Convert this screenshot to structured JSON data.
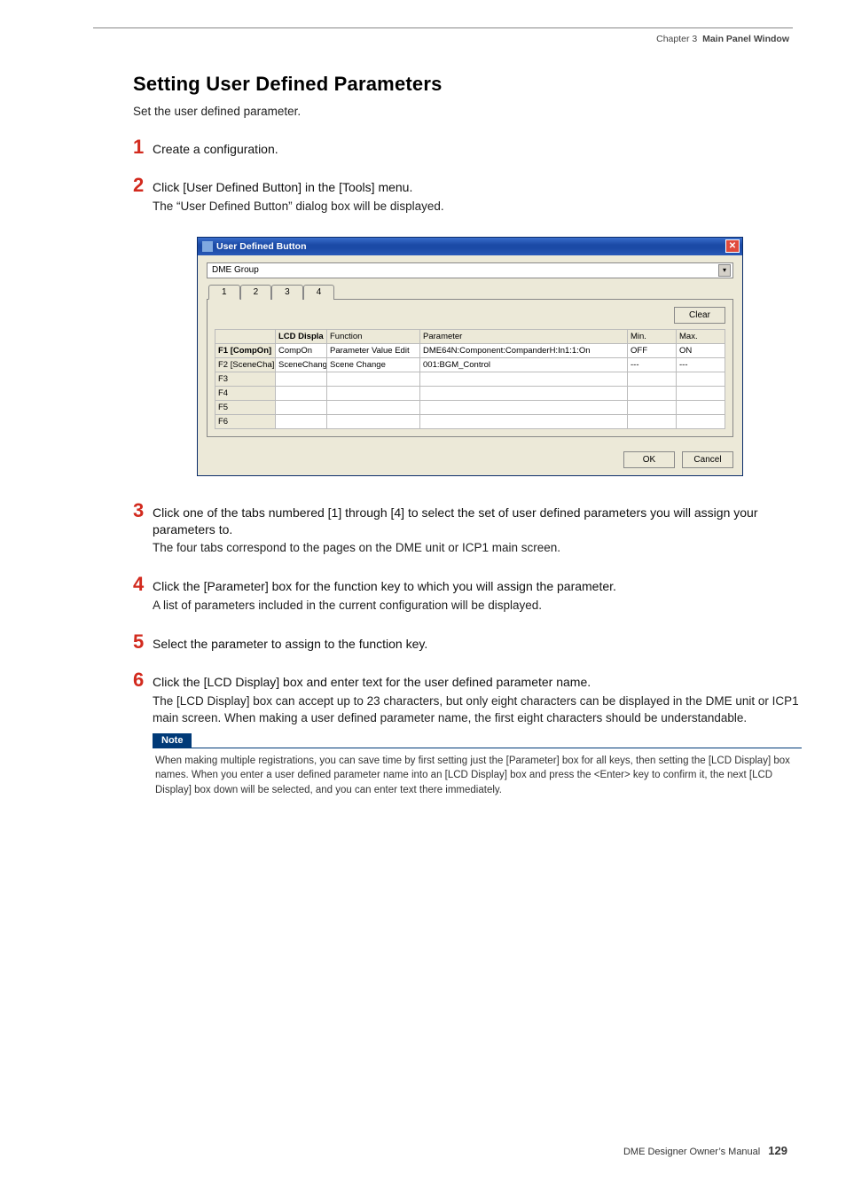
{
  "header": {
    "chapter": "Chapter 3",
    "title": "Main Panel Window"
  },
  "page": {
    "h1": "Setting User Defined Parameters",
    "intro": "Set the user defined parameter.",
    "steps": {
      "s1": {
        "n": "1",
        "head": "Create a configuration."
      },
      "s2": {
        "n": "2",
        "head": "Click [User Defined Button] in the [Tools] menu.",
        "sub": "The “User Defined Button” dialog box will be displayed."
      },
      "s3": {
        "n": "3",
        "head": "Click one of the tabs numbered [1] through [4] to select the set of user defined parameters you will assign your parameters to.",
        "sub": "The four tabs correspond to the pages on the DME unit or ICP1 main screen."
      },
      "s4": {
        "n": "4",
        "head": "Click the [Parameter] box for the function key to which you will assign the parameter.",
        "sub": "A list of parameters included in the current configuration will be displayed."
      },
      "s5": {
        "n": "5",
        "head": "Select the parameter to assign to the function key."
      },
      "s6": {
        "n": "6",
        "head": "Click the [LCD Display] box and enter text for the user defined parameter name.",
        "sub": "The [LCD Display] box can accept up to 23 characters, but only eight characters can be displayed in the DME unit or ICP1 main screen. When making a user defined parameter name, the first eight characters should be understandable."
      }
    },
    "note": {
      "label": "Note",
      "text": "When making multiple registrations, you can save time by first setting just the [Parameter] box for all keys, then setting the [LCD Display] box names. When you enter a user defined parameter name into an [LCD Display] box and press the <Enter> key to confirm it, the next [LCD Display] box down will be selected, and you can enter text there immediately."
    }
  },
  "dialog": {
    "title": "User Defined Button",
    "group": "DME Group",
    "tabs": [
      "1",
      "2",
      "3",
      "4"
    ],
    "clear": "Clear",
    "ok": "OK",
    "cancel": "Cancel",
    "dd_arrow": "▾",
    "close_glyph": "✕",
    "columns": {
      "rowh": "",
      "lcd": "LCD Displa",
      "func": "Function",
      "param": "Parameter",
      "min": "Min.",
      "max": "Max."
    },
    "rows": {
      "r1": {
        "h": "F1 [CompOn]",
        "lcd": "CompOn",
        "func": "Parameter Value Edit",
        "param": "DME64N:Component:CompanderH:In1:1:On",
        "min": "OFF",
        "max": "ON"
      },
      "r2": {
        "h": "F2 [SceneCha]",
        "lcd": "SceneChange",
        "func": "Scene Change",
        "param": "001:BGM_Control",
        "min": "---",
        "max": "---"
      },
      "r3": {
        "h": "F3"
      },
      "r4": {
        "h": "F4"
      },
      "r5": {
        "h": "F5"
      },
      "r6": {
        "h": "F6"
      }
    }
  },
  "footer": {
    "text": "DME Designer Owner’s Manual",
    "page": "129"
  }
}
